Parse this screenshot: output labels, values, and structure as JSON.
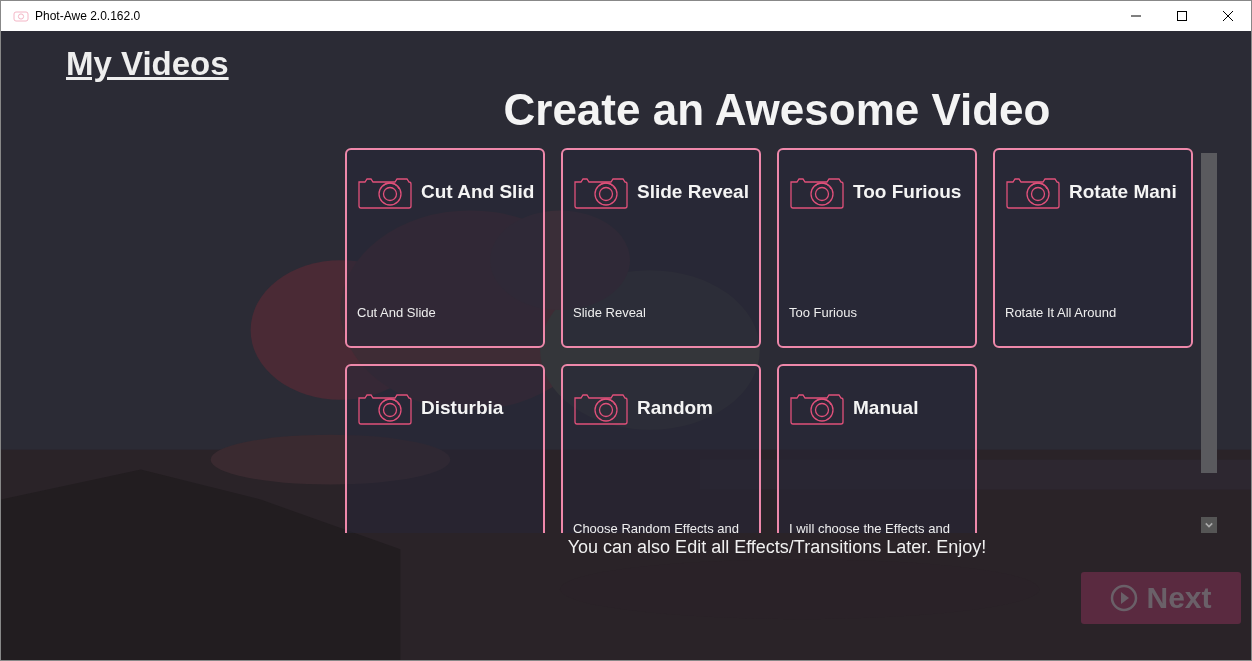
{
  "window": {
    "title": "Phot-Awe 2.0.162.0"
  },
  "my_videos_link": "My Videos",
  "heading": "Create an Awesome Video",
  "templates": [
    {
      "title": "Cut And Slid",
      "description": "Cut And Slide"
    },
    {
      "title": "Slide Reveal",
      "description": "Slide Reveal"
    },
    {
      "title": "Too Furious",
      "description": "Too Furious"
    },
    {
      "title": "Rotate Mani",
      "description": "Rotate It All Around"
    },
    {
      "title": "Disturbia"
    },
    {
      "title": "Random",
      "description": "Choose Random Effects and"
    },
    {
      "title": "Manual",
      "description": "I will choose the Effects and"
    }
  ],
  "footer_note": "You can also Edit all Effects/Transitions Later. Enjoy!",
  "next_button": {
    "label": "Next",
    "disabled": true
  }
}
